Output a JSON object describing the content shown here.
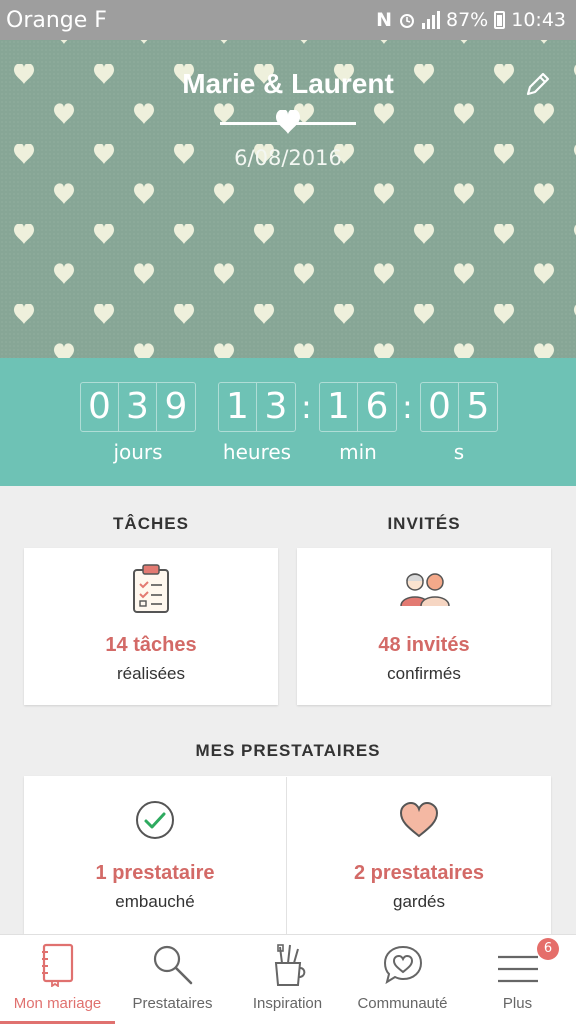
{
  "status_bar": {
    "carrier": "Orange F",
    "battery": "87%",
    "time": "10:43"
  },
  "header": {
    "title": "Marie & Laurent",
    "date": "6/08/2016"
  },
  "countdown": {
    "days_digits": [
      "0",
      "3",
      "9"
    ],
    "hours_digits": [
      "1",
      "3"
    ],
    "minutes_digits": [
      "1",
      "6"
    ],
    "seconds_digits": [
      "0",
      "5"
    ],
    "separator": ":",
    "labels": {
      "days": "jours",
      "hours": "heures",
      "minutes": "min",
      "seconds": "s"
    }
  },
  "tasks": {
    "section_title": "TÂCHES",
    "count": "14 tâches",
    "status": "réalisées"
  },
  "guests": {
    "section_title": "INVITÉS",
    "count": "48 invités",
    "status": "confirmés"
  },
  "vendors": {
    "section_title": "MES PRESTATAIRES",
    "hired": {
      "count": "1 prestataire",
      "status": "embauché"
    },
    "saved": {
      "count": "2 prestataires",
      "status": "gardés"
    }
  },
  "bottom_nav": {
    "items": [
      {
        "label": "Mon mariage",
        "icon": "notebook-icon"
      },
      {
        "label": "Prestataires",
        "icon": "search-icon"
      },
      {
        "label": "Inspiration",
        "icon": "brushes-cup-icon"
      },
      {
        "label": "Communauté",
        "icon": "heart-chat-icon"
      },
      {
        "label": "Plus",
        "icon": "menu-icon"
      }
    ],
    "badge": "6"
  },
  "colors": {
    "teal": "#6ec2b5",
    "accent": "#e0716f",
    "header_bg": "#87a696"
  }
}
